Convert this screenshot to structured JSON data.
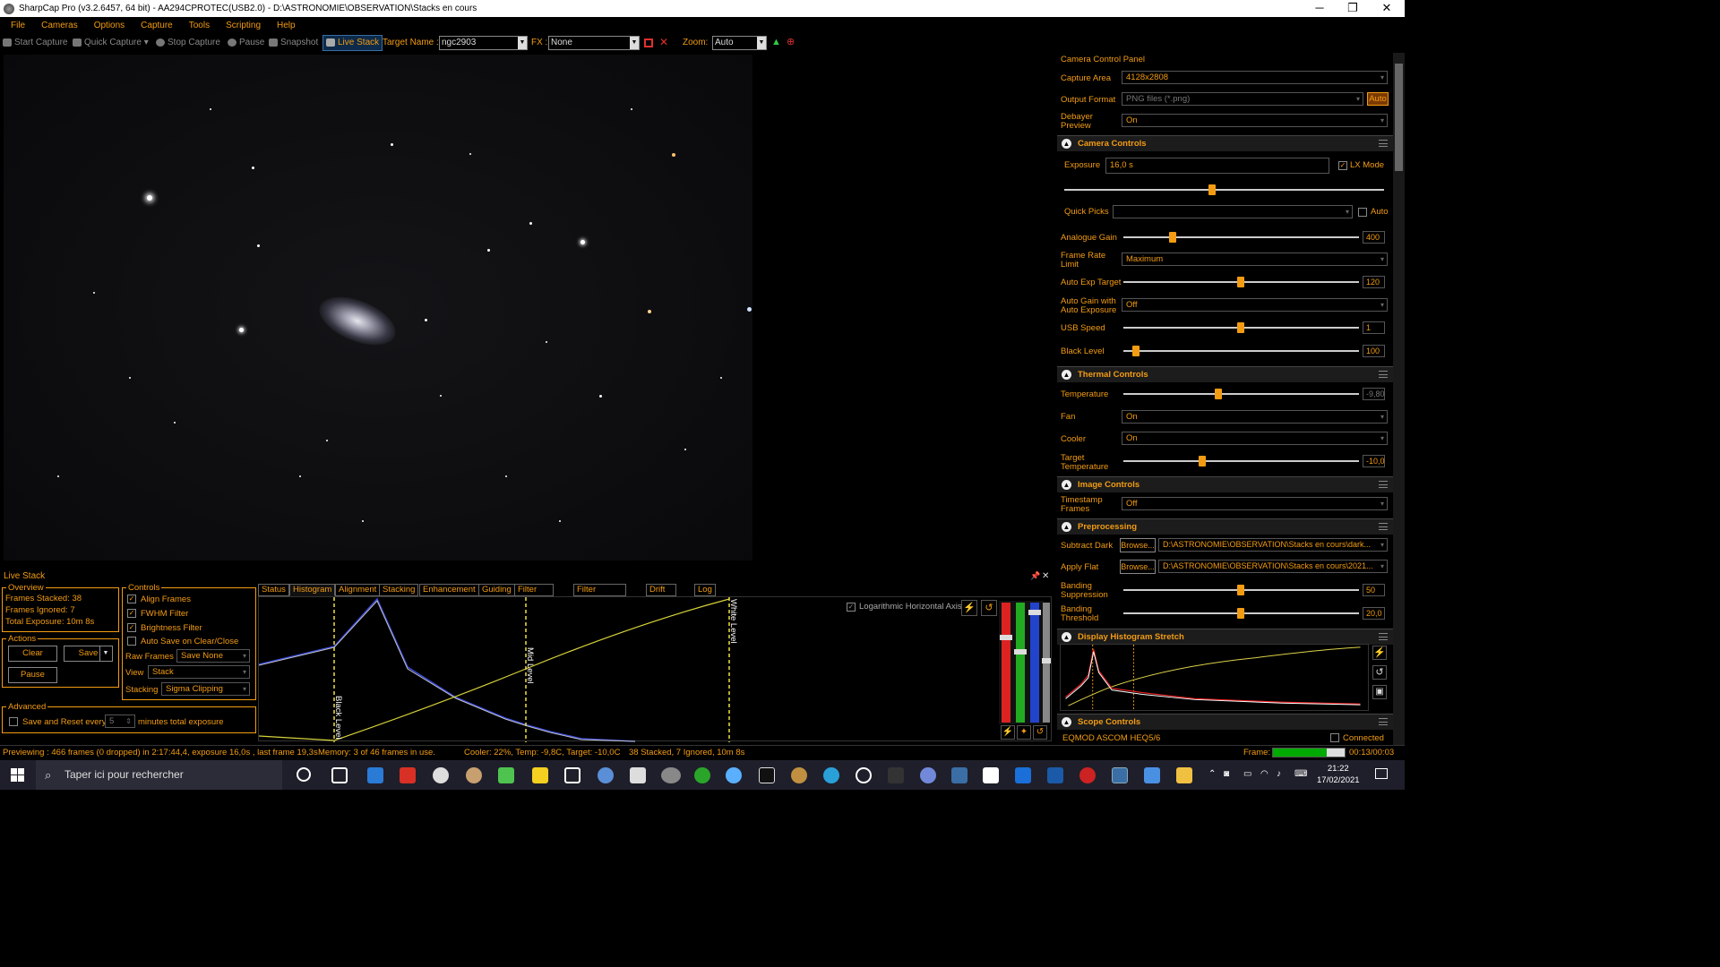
{
  "window": {
    "title": "SharpCap Pro (v3.2.6457, 64 bit) - AA294CPROTEC(USB2.0) - D:\\ASTRONOMIE\\OBSERVATION\\Stacks en cours",
    "minimize": "─",
    "maximize": "❐",
    "close": "✕"
  },
  "menu": [
    "File",
    "Cameras",
    "Options",
    "Capture",
    "Tools",
    "Scripting",
    "Help"
  ],
  "toolbar": {
    "start": "Start Capture",
    "quick": "Quick Capture",
    "stop": "Stop Capture",
    "pause": "Pause",
    "snapshot": "Snapshot",
    "livestack": "Live Stack",
    "target_label": "Target Name :",
    "target_value": "ngc2903",
    "fx_label": "FX :",
    "fx_value": "None",
    "zoom_label": "Zoom:",
    "zoom_value": "Auto"
  },
  "panel": {
    "title": "Camera Control Panel",
    "capture_area_label": "Capture Area",
    "capture_area": "4128x2808",
    "output_format_label": "Output Format",
    "output_format": "PNG files (*.png)",
    "auto_btn": "Auto",
    "debayer_label1": "Debayer",
    "debayer_label2": "Preview",
    "debayer": "On",
    "camera_controls": "Camera Controls",
    "exposure_label": "Exposure",
    "exposure": "16,0 s",
    "lx_mode": "LX Mode",
    "quick_picks_label": "Quick Picks",
    "quick_auto": "Auto",
    "gain_label": "Analogue Gain",
    "gain": "400",
    "framerate_label1": "Frame Rate",
    "framerate_label2": "Limit",
    "framerate": "Maximum",
    "autoexp_label": "Auto Exp Target",
    "autoexp": "120",
    "autogain_label1": "Auto Gain with",
    "autogain_label2": "Auto Exposure",
    "autogain": "Off",
    "usb_label": "USB Speed",
    "usb": "1",
    "black_label": "Black Level",
    "black": "100",
    "thermal": "Thermal Controls",
    "temp_label": "Temperature",
    "temp": "-9,80",
    "fan_label": "Fan",
    "fan": "On",
    "cooler_label": "Cooler",
    "cooler": "On",
    "target_temp_label1": "Target",
    "target_temp_label2": "Temperature",
    "target_temp": "-10,0",
    "image_controls": "Image Controls",
    "timestamp_label1": "Timestamp",
    "timestamp_label2": "Frames",
    "timestamp": "Off",
    "preprocessing": "Preprocessing",
    "dark_label": "Subtract Dark",
    "browse": "Browse...",
    "dark_path": "D:\\ASTRONOMIE\\OBSERVATION\\Stacks en cours\\dark...",
    "flat_label": "Apply Flat",
    "flat_path": "D:\\ASTRONOMIE\\OBSERVATION\\Stacks en cours\\2021...",
    "banding_sup_label1": "Banding",
    "banding_sup_label2": "Suppression",
    "banding_sup": "50",
    "banding_thr_label1": "Banding",
    "banding_thr_label2": "Threshold",
    "banding_thr": "20,0",
    "display_hist": "Display Histogram Stretch",
    "scope": "Scope Controls",
    "scope_device": "EQMOD ASCOM HEQ5/6",
    "connected": "Connected"
  },
  "livestack": {
    "title": "Live Stack",
    "overview": "Overview",
    "frames_stacked": "Frames Stacked: 38",
    "frames_ignored": "Frames Ignored:  7",
    "total_exposure": "Total Exposure:   10m 8s",
    "actions": "Actions",
    "clear": "Clear",
    "save": "Save",
    "pause": "Pause",
    "controls": "Controls",
    "align": "Align Frames",
    "fwhm": "FWHM Filter",
    "brightness": "Brightness Filter",
    "autosave": "Auto Save on Clear/Close",
    "raw_label": "Raw Frames",
    "raw": "Save None",
    "view_label": "View",
    "view": "Stack",
    "stacking_label": "Stacking",
    "stacking": "Sigma Clipping",
    "advanced": "Advanced",
    "save_reset": "Save and Reset every",
    "minutes_value": "5",
    "minutes": "minutes total exposure",
    "tabs": [
      "Status",
      "Histogram",
      "Alignment",
      "Stacking",
      "Enhancement",
      "Guiding",
      "Filter (FWHM)",
      "Filter (Brightness)",
      "Drift Graph",
      "Log"
    ],
    "log_axis": "Logarithmic Horizontal Axis",
    "black_level": "Black Level",
    "mid_level": "Mid Level",
    "white_level": "White Level",
    "pin": "📌",
    "close": "✕"
  },
  "status": {
    "preview": "Previewing : 466 frames (0 dropped) in 2:17:44,4, exposure 16,0s , last frame 19,3s",
    "memory": "Memory: 3 of 46 frames in use.",
    "cooler": "Cooler: 22%, Temp: -9,8C, Target: -10,0C",
    "stacked": "38 Stacked, 7 Ignored, 10m 8s",
    "frame_label": "Frame:",
    "frame_time": "00:13/00:03"
  },
  "taskbar": {
    "search": "Taper ici pour rechercher",
    "time": "21:22",
    "date": "17/02/2021"
  }
}
